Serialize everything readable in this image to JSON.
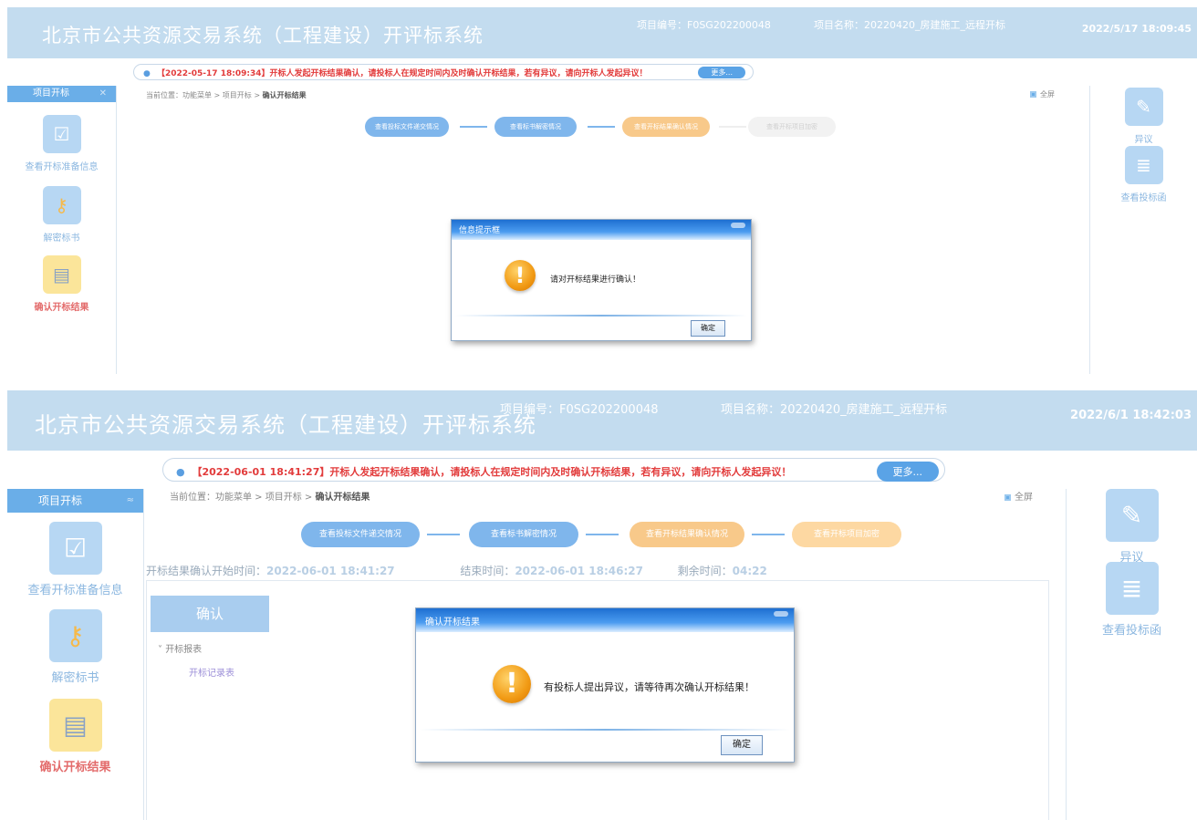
{
  "shots": [
    {
      "header": {
        "system_title": "北京市公共资源交易系统（工程建设）开评标系统",
        "project_no": "项目编号：F0SG202200048",
        "project_name": "项目名称：20220420_房建施工_远程开标",
        "clock": "2022/5/17 18:09:45"
      },
      "notice": {
        "text": "【2022-05-17 18:09:34】开标人发起开标结果确认，请投标人在规定时间内及时确认开标结果，若有异议，请向开标人发起异议！",
        "more": "更多..."
      },
      "left_nav": {
        "title": "项目开标",
        "items": [
          "查看开标准备信息",
          "解密标书",
          "确认开标结果"
        ]
      },
      "right_nav": {
        "items": [
          "异议",
          "查看投标函"
        ]
      },
      "breadcrumb": {
        "prefix": "当前位置：功能菜单 > 项目开标 > ",
        "current": "确认开标结果"
      },
      "fullscreen": "全屏",
      "steps": [
        "查看投标文件递交情况",
        "查看标书解密情况",
        "查看开标结果确认情况",
        "查看开标项目加密"
      ],
      "dialog": {
        "title": "信息提示框",
        "message": "请对开标结果进行确认！",
        "ok": "确定"
      }
    },
    {
      "header": {
        "system_title": "北京市公共资源交易系统（工程建设）开评标系统",
        "project_no": "项目编号：F0SG202200048",
        "project_name": "项目名称：20220420_房建施工_远程开标",
        "clock": "2022/6/1 18:42:03"
      },
      "notice": {
        "text": "【2022-06-01 18:41:27】开标人发起开标结果确认，请投标人在规定时间内及时确认开标结果，若有异议，请向开标人发起异议！",
        "more": "更多..."
      },
      "left_nav": {
        "title": "项目开标",
        "items": [
          "查看开标准备信息",
          "解密标书",
          "确认开标结果"
        ]
      },
      "right_nav": {
        "items": [
          "异议",
          "查看投标函"
        ]
      },
      "breadcrumb": {
        "prefix": "当前位置：功能菜单 > 项目开标 > ",
        "current": "确认开标结果"
      },
      "fullscreen": "全屏",
      "steps": [
        "查看投标文件递交情况",
        "查看标书解密情况",
        "查看开标结果确认情况",
        "查看开标项目加密"
      ],
      "timebar": {
        "start_label": "开标结果确认开始时间：",
        "start_value": "2022-06-01 18:41:27",
        "end_label": "结束时间：",
        "end_value": "2022-06-01 18:46:27",
        "remain_label": "剩余时间：",
        "remain_value": "04:22"
      },
      "content": {
        "confirm": "确认",
        "tree_root": "开标报表",
        "tree_leaf": "开标记录表"
      },
      "dialog": {
        "title": "确认开标结果",
        "message": "有投标人提出异议，请等待再次确认开标结果！",
        "ok": "确定"
      }
    }
  ],
  "colors": {
    "header": "#c3dcef",
    "accent": "#6aaee8",
    "warn": "#f19a14",
    "notice_text": "#e23b3b",
    "active_nav": "#e36b6b"
  },
  "icons": [
    "checklist-icon",
    "key-icon",
    "calendar-icon",
    "edit-icon",
    "stack-icon",
    "warning-icon",
    "fullscreen-icon"
  ]
}
